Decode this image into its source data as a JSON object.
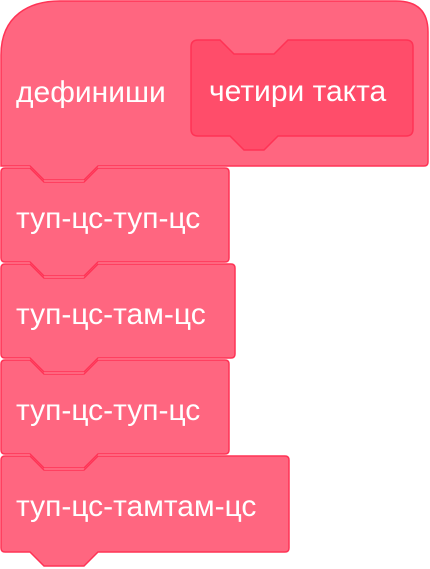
{
  "definition": {
    "keyword": "дефиниши",
    "name": "четири такта"
  },
  "blocks": [
    {
      "label": "туп-цс-туп-цс"
    },
    {
      "label": "туп-цс-там-цс"
    },
    {
      "label": "туп-цс-туп-цс"
    },
    {
      "label": "туп-цс-тамтам-цс"
    }
  ],
  "colors": {
    "block_fill": "#FF6680",
    "block_stroke": "#FF3355",
    "prototype_fill": "#FF4D6A",
    "text": "#FFFFFF"
  }
}
